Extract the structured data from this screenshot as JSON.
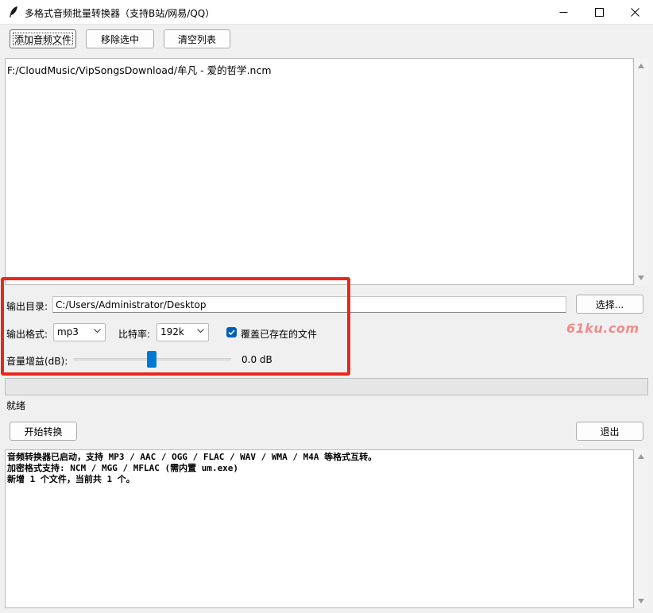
{
  "window": {
    "title": "多格式音频批量转换器（支持B站/网易/QQ）"
  },
  "toolbar": {
    "add_label": "添加音频文件",
    "remove_label": "移除选中",
    "clear_label": "清空列表"
  },
  "file_list": {
    "items": [
      "F:/CloudMusic/VipSongsDownload/牟凡 - 爱的哲学.ncm"
    ]
  },
  "settings": {
    "output_dir_label": "输出目录:",
    "output_dir_value": "C:/Users/Administrator/Desktop",
    "browse_label": "选择...",
    "format_label": "输出格式:",
    "format_value": "mp3",
    "bitrate_label": "比特率:",
    "bitrate_value": "192k",
    "overwrite_label": "覆盖已存在的文件",
    "overwrite_checked": true,
    "gain_label": "音量增益(dB):",
    "gain_value": "0.0 dB"
  },
  "watermark": "61ku.com",
  "status": {
    "text": "就绪"
  },
  "actions": {
    "start_label": "开始转换",
    "exit_label": "退出"
  },
  "log": {
    "lines": [
      "音频转换器已启动，支持 MP3 / AAC / OGG / FLAC / WAV / WMA / M4A 等格式互转。",
      "加密格式支持: NCM / MGG / MFLAC (需内置 um.exe)",
      "新增 1 个文件，当前共 1 个。"
    ]
  },
  "colors": {
    "accent": "#0078d4",
    "checkbox": "#005fb8",
    "highlight_box": "#e8271d"
  }
}
